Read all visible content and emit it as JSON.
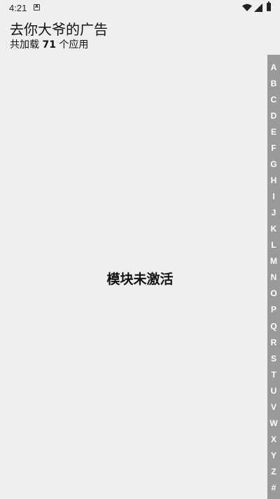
{
  "status_bar": {
    "time": "4:21",
    "notification_icon": "a-icon",
    "icons": [
      "wifi-icon",
      "signal-icon",
      "battery-icon"
    ]
  },
  "header": {
    "title": "去你大爷的广告",
    "subtitle_prefix": "共加载",
    "app_count": "71",
    "subtitle_suffix": "个应用"
  },
  "main": {
    "message": "模块未激活"
  },
  "alpha_index": {
    "letters": [
      "A",
      "B",
      "C",
      "D",
      "E",
      "F",
      "G",
      "H",
      "I",
      "J",
      "K",
      "L",
      "M",
      "N",
      "O",
      "P",
      "Q",
      "R",
      "S",
      "T",
      "U",
      "V",
      "W",
      "X",
      "Y",
      "Z",
      "#"
    ]
  },
  "colors": {
    "background": "#efefef",
    "index_bar": "#9a9a9a",
    "index_text": "#ffffff"
  }
}
